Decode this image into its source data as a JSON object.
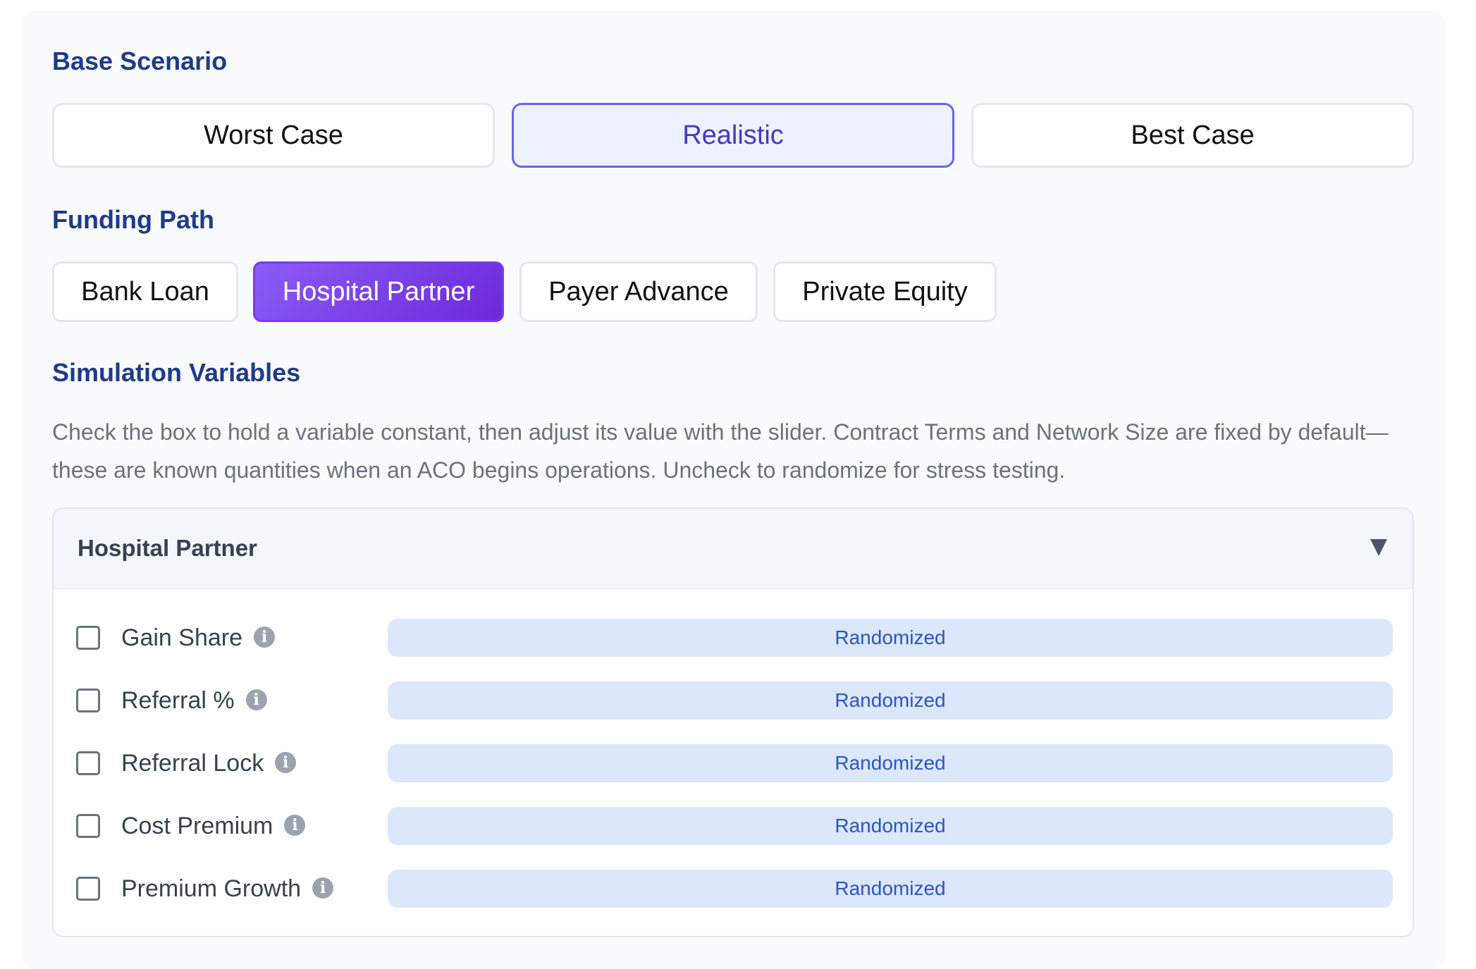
{
  "base_scenario": {
    "title": "Base Scenario",
    "options": [
      "Worst Case",
      "Realistic",
      "Best Case"
    ],
    "selected": "Realistic"
  },
  "funding_path": {
    "title": "Funding Path",
    "options": [
      "Bank Loan",
      "Hospital Partner",
      "Payer Advance",
      "Private Equity"
    ],
    "selected": "Hospital Partner"
  },
  "simulation_variables": {
    "title": "Simulation Variables",
    "description": "Check the box to hold a variable constant, then adjust its value with the slider. Contract Terms and Network Size are fixed by default—these are known quantities when an ACO begins operations. Uncheck to randomize for stress testing.",
    "group": {
      "title": "Hospital Partner",
      "expanded": true,
      "variables": [
        {
          "label": "Gain Share",
          "info_icon": "i",
          "checked": false,
          "status": "Randomized"
        },
        {
          "label": "Referral %",
          "info_icon": "i",
          "checked": false,
          "status": "Randomized"
        },
        {
          "label": "Referral Lock",
          "info_icon": "i",
          "checked": false,
          "status": "Randomized"
        },
        {
          "label": "Cost Premium",
          "info_icon": "i",
          "checked": false,
          "status": "Randomized"
        },
        {
          "label": "Premium Growth",
          "info_icon": "i",
          "checked": false,
          "status": "Randomized"
        }
      ]
    }
  },
  "colors": {
    "heading": "#1e3a8a",
    "selected_scenario_border": "#6366f1",
    "selected_scenario_bg": "#eef2ff",
    "selected_funding_gradient_start": "#8b5cf6",
    "selected_funding_gradient_end": "#6d28d9",
    "randomized_bar_bg": "#dbe7fb",
    "randomized_text": "#2b55c6"
  }
}
